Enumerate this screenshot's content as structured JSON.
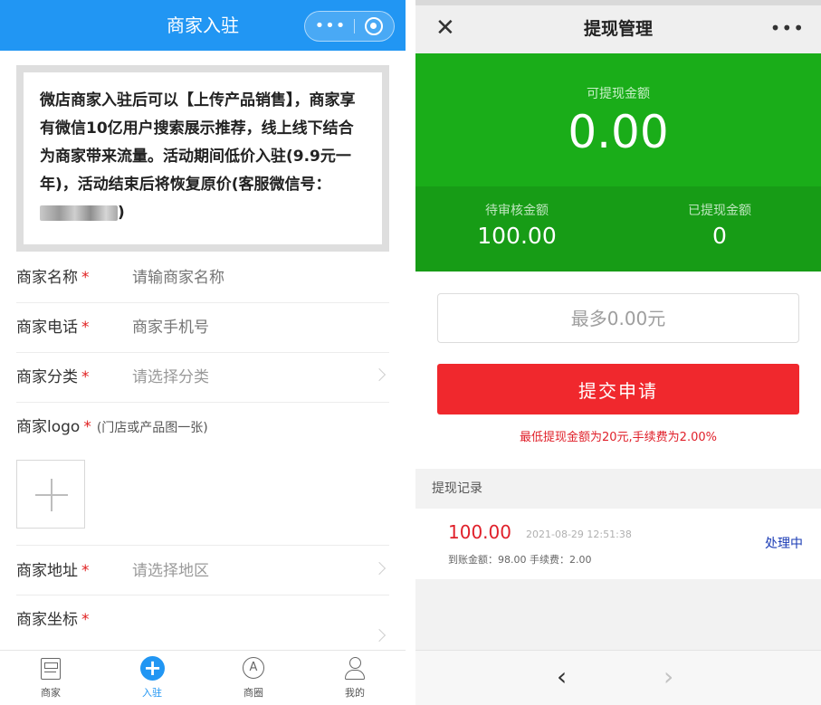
{
  "left": {
    "header": {
      "title": "商家入驻",
      "more_glyph": "•••"
    },
    "notice": {
      "text": "微店商家入驻后可以【上传产品销售】，商家享有微信10亿用户搜索展示推荐，线上线下结合为商家带来流量。活动期间低价入驻(9.9元一年)，活动结束后将恢复原价(客服微信号：",
      "closing": ")"
    },
    "form": {
      "name": {
        "label": "商家名称",
        "placeholder": "请输商家名称"
      },
      "phone": {
        "label": "商家电话",
        "placeholder": "商家手机号"
      },
      "category": {
        "label": "商家分类",
        "placeholder": "请选择分类"
      },
      "logo": {
        "label": "商家logo",
        "sub": "(门店或产品图一张)"
      },
      "address": {
        "label": "商家地址",
        "placeholder": "请选择地区"
      },
      "coords": {
        "label": "商家坐标"
      },
      "required_mark": "*"
    },
    "tabbar": [
      {
        "label": "商家",
        "icon": "shop-icon"
      },
      {
        "label": "入驻",
        "icon": "plus-circle-icon"
      },
      {
        "label": "商圈",
        "icon": "circle-a-icon"
      },
      {
        "label": "我的",
        "icon": "user-icon"
      }
    ]
  },
  "right": {
    "header": {
      "title": "提现管理",
      "close_glyph": "✕",
      "more_glyph": "•••"
    },
    "available": {
      "label": "可提现金额",
      "value": "0.00"
    },
    "pending": {
      "label": "待审核金额",
      "value": "100.00"
    },
    "withdrawn": {
      "label": "已提现金额",
      "value": "0"
    },
    "amount_placeholder": "最多0.00元",
    "submit_label": "提交申请",
    "tip": "最低提现金额为20元,手续费为2.00%",
    "records_title": "提现记录",
    "record": {
      "amount": "100.00",
      "datetime": "2021-08-29 12:51:38",
      "detail": "到账金额：98.00   手续费：2.00",
      "status": "处理中"
    },
    "nav": {
      "back_glyph": "‹",
      "forward_glyph": "›"
    },
    "colors": {
      "green": "#1aad19",
      "red": "#f0282d",
      "blue": "#2196f3"
    }
  }
}
